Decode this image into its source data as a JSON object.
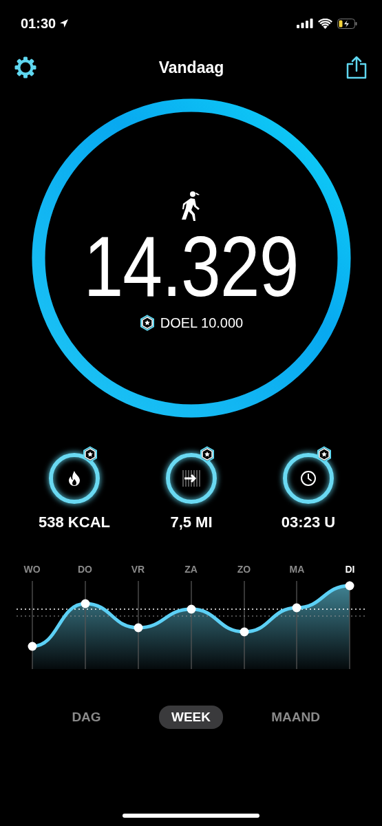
{
  "status_bar": {
    "time": "01:30"
  },
  "header": {
    "title": "Vandaag"
  },
  "steps": {
    "value": "14.329",
    "goal": "DOEL 10.000",
    "goal_reached": true
  },
  "stats": [
    {
      "kind": "calories",
      "value": "538 KCAL",
      "goal_reached": true
    },
    {
      "kind": "distance",
      "value": "7,5 MI",
      "goal_reached": true
    },
    {
      "kind": "time",
      "value": "03:23 U",
      "goal_reached": true
    }
  ],
  "week": {
    "days": [
      {
        "label": "WO",
        "selected": false
      },
      {
        "label": "DO",
        "selected": false
      },
      {
        "label": "VR",
        "selected": false
      },
      {
        "label": "ZA",
        "selected": false
      },
      {
        "label": "ZO",
        "selected": false
      },
      {
        "label": "MA",
        "selected": false
      },
      {
        "label": "DI",
        "selected": true
      }
    ]
  },
  "periods": [
    {
      "label": "DAG",
      "selected": false
    },
    {
      "label": "WEEK",
      "selected": true
    },
    {
      "label": "MAAND",
      "selected": false
    }
  ]
}
